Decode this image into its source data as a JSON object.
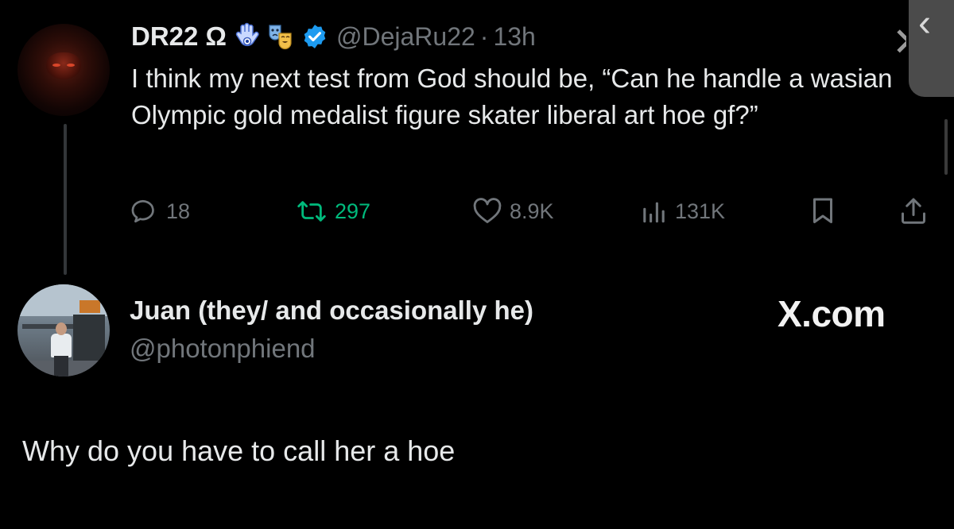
{
  "tweet": {
    "author_name": "DR22 Ω",
    "author_handle": "@DejaRu22",
    "separator": "·",
    "timestamp": "13h",
    "text": "I think my next test from God should be, “Can he handle a wasian Olympic gold medalist figure skater liberal art hoe gf?”",
    "emoji_badges": [
      "hamsa-emoji",
      "theater-masks-emoji"
    ],
    "verified": true,
    "actions": {
      "replies": "18",
      "reposts": "297",
      "likes": "8.9K",
      "views": "131K"
    }
  },
  "reply": {
    "author_name": "Juan (they/ and occasionally he)",
    "author_handle": "@photonphiend",
    "text": "Why do you have to call her a hoe"
  },
  "watermark": "X.com",
  "icons": {
    "reply": "reply-bubble-icon",
    "repost": "repost-arrows-icon",
    "like": "heart-icon",
    "views": "bar-chart-icon",
    "bookmark": "bookmark-icon",
    "share": "share-upload-icon",
    "close": "close-x-icon",
    "back": "chevron-left-icon"
  },
  "colors": {
    "background": "#000000",
    "text_primary": "#e7e9ea",
    "text_secondary": "#71767b",
    "repost_active": "#00ba7c",
    "verified_blue": "#1d9bf0"
  }
}
